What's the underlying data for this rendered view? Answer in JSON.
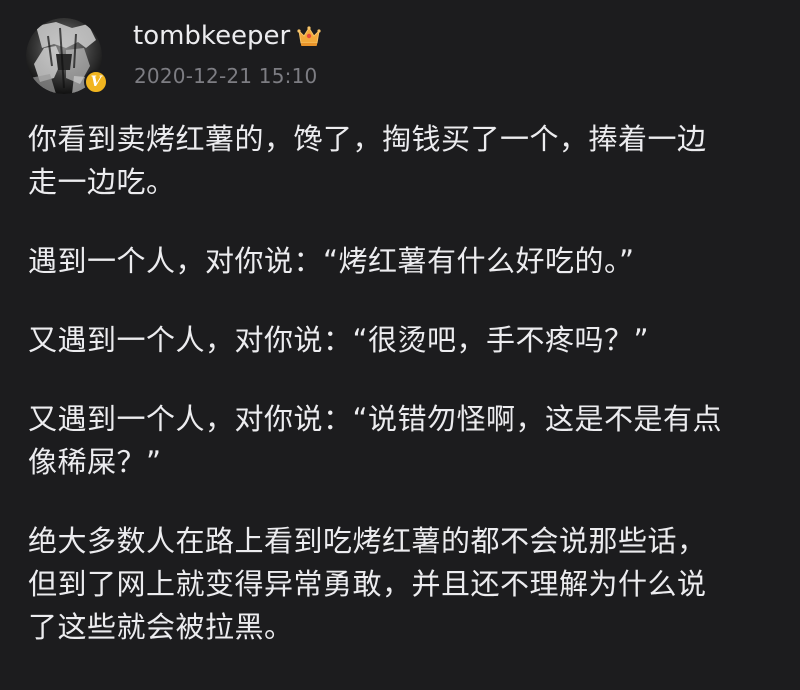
{
  "post": {
    "author": {
      "username": "tombkeeper",
      "timestamp": "2020-12-21 15:10",
      "badge_icon": "crown-icon",
      "verified_icon": "verified-v-icon",
      "verified_letter": "V",
      "accent_color": "#f1b51f"
    },
    "paragraphs": [
      {
        "lines": [
          "你看到卖烤红薯的，馋了，掏钱买了一个，捧着一边",
          "走一边吃。"
        ]
      },
      {
        "lines": [
          "遇到一个人，对你说：“烤红薯有什么好吃的。”"
        ]
      },
      {
        "lines": [
          "又遇到一个人，对你说：“很烫吧，手不疼吗？”"
        ]
      },
      {
        "lines": [
          "又遇到一个人，对你说：“说错勿怪啊，这是不是有点",
          "像稀屎？”"
        ]
      },
      {
        "lines": [
          "绝大多数人在路上看到吃烤红薯的都不会说那些话，",
          "但到了网上就变得异常勇敢，并且还不理解为什么说",
          "了这些就会被拉黑。"
        ]
      }
    ],
    "colors": {
      "background": "#1c1c1e",
      "text": "#ececef",
      "timestamp": "#7d7d83"
    }
  }
}
